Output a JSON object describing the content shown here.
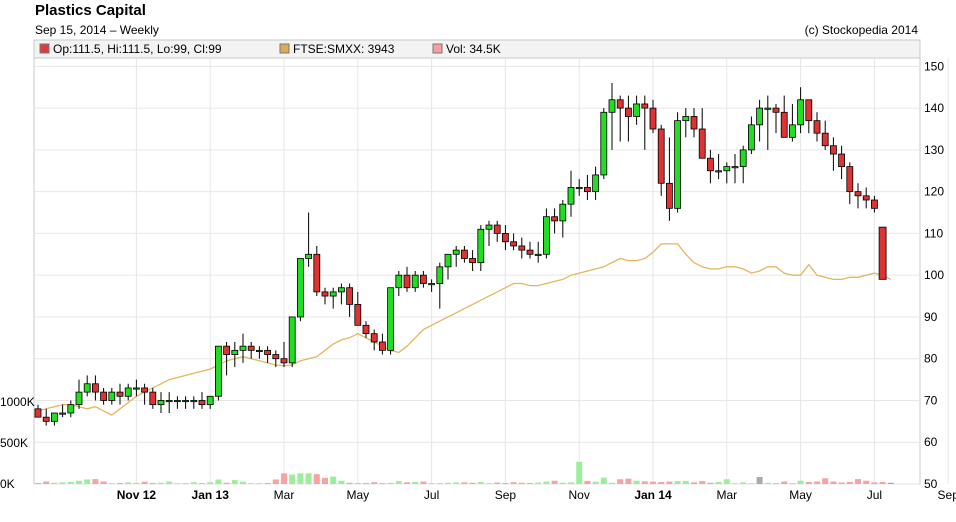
{
  "header": {
    "title": "Plastics Capital",
    "subtitle": "Sep 15, 2014  – Weekly",
    "credit": "(c) Stockopedia 2014"
  },
  "legend": [
    {
      "label": "Op:111.5, Hi:111.5, Lo:99, Cl:99",
      "color": "#e03c3c"
    },
    {
      "label": "FTSE:SMXX: 3943",
      "color": "#e0a85a"
    },
    {
      "label": "Vol: 34.5K",
      "color": "#f4a0a0"
    }
  ],
  "colors": {
    "up": "#22dd22",
    "down": "#dd3333",
    "index_line": "#e3b65f",
    "vol_up": "#9cee9c",
    "vol_down": "#f4a4a4",
    "vol_neutral": "#aaaaaa",
    "grid": "#e6e6e6"
  },
  "chart_data": {
    "type": "candlestick",
    "price_axis": {
      "ticks": [
        50,
        60,
        70,
        80,
        90,
        100,
        110,
        120,
        130,
        140,
        150
      ],
      "ylim": [
        50,
        152
      ]
    },
    "volume_axis": {
      "ticks": [
        "0K",
        "500K",
        "1000K"
      ],
      "values": [
        0,
        500,
        1000
      ]
    },
    "x_ticks": [
      {
        "label": "Nov 12",
        "week": 12,
        "bold": true
      },
      {
        "label": "Jan 13",
        "week": 21,
        "bold": true
      },
      {
        "label": "Mar",
        "week": 30,
        "bold": false
      },
      {
        "label": "May",
        "week": 39,
        "bold": false
      },
      {
        "label": "Jul",
        "week": 48,
        "bold": false
      },
      {
        "label": "Sep",
        "week": 57,
        "bold": false
      },
      {
        "label": "Nov",
        "week": 66,
        "bold": false
      },
      {
        "label": "Jan 14",
        "week": 75,
        "bold": true
      },
      {
        "label": "Mar",
        "week": 84,
        "bold": false
      },
      {
        "label": "May",
        "week": 93,
        "bold": false
      },
      {
        "label": "Jul",
        "week": 102,
        "bold": false
      },
      {
        "label": "Sep",
        "week": 111,
        "bold": false
      }
    ],
    "candles": [
      [
        68,
        69,
        66,
        66
      ],
      [
        66,
        68,
        64,
        65
      ],
      [
        65,
        67,
        64,
        67
      ],
      [
        67,
        69,
        66,
        67
      ],
      [
        67,
        70,
        66,
        69
      ],
      [
        69,
        75,
        68,
        72
      ],
      [
        72,
        76,
        71,
        74
      ],
      [
        74,
        76,
        70,
        72
      ],
      [
        72,
        73,
        69,
        70
      ],
      [
        70,
        73,
        69,
        72
      ],
      [
        72,
        74,
        69,
        71
      ],
      [
        71,
        74,
        70,
        73
      ],
      [
        73,
        75,
        71,
        73
      ],
      [
        73,
        74,
        69,
        72
      ],
      [
        72,
        73,
        68,
        69
      ],
      [
        69,
        72,
        67,
        70
      ],
      [
        70,
        72,
        67,
        70
      ],
      [
        70,
        71,
        68,
        70
      ],
      [
        70,
        71,
        68,
        70
      ],
      [
        70,
        71,
        68,
        70
      ],
      [
        70,
        72,
        68,
        69
      ],
      [
        69,
        71,
        68,
        71
      ],
      [
        71,
        82,
        70,
        83
      ],
      [
        83,
        84,
        76,
        81
      ],
      [
        81,
        84,
        78,
        82
      ],
      [
        82,
        86,
        79,
        83
      ],
      [
        83,
        84,
        80,
        82
      ],
      [
        82,
        83,
        80,
        82
      ],
      [
        82,
        83,
        79,
        81
      ],
      [
        81,
        82,
        78,
        80
      ],
      [
        80,
        84,
        78,
        79
      ],
      [
        79,
        90,
        78,
        90
      ],
      [
        90,
        104,
        89,
        104
      ],
      [
        104,
        115,
        102,
        105
      ],
      [
        105,
        107,
        95,
        96
      ],
      [
        96,
        97,
        93,
        95
      ],
      [
        95,
        97,
        92,
        96
      ],
      [
        96,
        98,
        93,
        97
      ],
      [
        97,
        98,
        90,
        93
      ],
      [
        93,
        96,
        88,
        88
      ],
      [
        88,
        89,
        85,
        86
      ],
      [
        86,
        87,
        82,
        84
      ],
      [
        84,
        86,
        81,
        82
      ],
      [
        82,
        97,
        81,
        97
      ],
      [
        97,
        101,
        95,
        100
      ],
      [
        100,
        102,
        96,
        97
      ],
      [
        97,
        101,
        96,
        100
      ],
      [
        100,
        101,
        97,
        98
      ],
      [
        98,
        99,
        96,
        98
      ],
      [
        98,
        103,
        92,
        102
      ],
      [
        102,
        105,
        99,
        105
      ],
      [
        105,
        107,
        102,
        106
      ],
      [
        106,
        107,
        103,
        104
      ],
      [
        104,
        106,
        101,
        103
      ],
      [
        103,
        112,
        101,
        111
      ],
      [
        111,
        113,
        107,
        112
      ],
      [
        112,
        113,
        108,
        110
      ],
      [
        110,
        112,
        106,
        108
      ],
      [
        108,
        110,
        106,
        107
      ],
      [
        107,
        109,
        104,
        106
      ],
      [
        106,
        108,
        104,
        105
      ],
      [
        105,
        108,
        103,
        105
      ],
      [
        105,
        116,
        104,
        114
      ],
      [
        114,
        116,
        110,
        113
      ],
      [
        113,
        118,
        109,
        117
      ],
      [
        117,
        125,
        114,
        121
      ],
      [
        121,
        123,
        119,
        121
      ],
      [
        121,
        124,
        118,
        120
      ],
      [
        120,
        126,
        118,
        124
      ],
      [
        124,
        140,
        123,
        139
      ],
      [
        139,
        146,
        130,
        142
      ],
      [
        142,
        143,
        132,
        140
      ],
      [
        140,
        143,
        132,
        138
      ],
      [
        138,
        143,
        136,
        141
      ],
      [
        141,
        143,
        130,
        140
      ],
      [
        140,
        142,
        134,
        135
      ],
      [
        135,
        136,
        119,
        122
      ],
      [
        122,
        133,
        113,
        116
      ],
      [
        116,
        139,
        115,
        137
      ],
      [
        137,
        140,
        133,
        138
      ],
      [
        138,
        140,
        133,
        135
      ],
      [
        135,
        140,
        129,
        128
      ],
      [
        128,
        130,
        122,
        125
      ],
      [
        125,
        129,
        123,
        125
      ],
      [
        125,
        127,
        122,
        126
      ],
      [
        126,
        129,
        122,
        126
      ],
      [
        126,
        131,
        122,
        130
      ],
      [
        130,
        138,
        129,
        136
      ],
      [
        136,
        142,
        132,
        140
      ],
      [
        140,
        143,
        130,
        140
      ],
      [
        140,
        141,
        134,
        139
      ],
      [
        139,
        143,
        133,
        133
      ],
      [
        133,
        141,
        132,
        136
      ],
      [
        136,
        145,
        134,
        142
      ],
      [
        142,
        142,
        134,
        137
      ],
      [
        137,
        139,
        132,
        134
      ],
      [
        134,
        137,
        130,
        131
      ],
      [
        131,
        133,
        125,
        129
      ],
      [
        129,
        131,
        123,
        126
      ],
      [
        126,
        127,
        117,
        120
      ],
      [
        120,
        122,
        116,
        119
      ],
      [
        119,
        121,
        116,
        118
      ],
      [
        118,
        119,
        115,
        116
      ],
      [
        111.5,
        111.5,
        99,
        99
      ]
    ],
    "index_line": [
      67.5,
      68,
      68.5,
      69,
      69,
      68.5,
      68,
      68.5,
      67.5,
      66.5,
      68,
      69.5,
      71,
      72,
      73,
      74,
      75,
      75.5,
      76,
      76.5,
      77,
      77.5,
      78.5,
      79.5,
      80,
      80.5,
      80,
      79.5,
      79,
      78.5,
      78.3,
      78.5,
      79.5,
      80,
      80.5,
      82,
      83.5,
      84.5,
      85,
      86,
      85,
      84,
      83,
      82,
      81.5,
      83,
      85,
      87,
      88,
      89,
      90,
      91,
      92,
      93,
      94,
      95,
      96,
      97,
      98,
      98,
      97.5,
      97.5,
      98,
      98.5,
      99,
      100,
      100.5,
      101,
      101.5,
      102,
      103,
      104,
      103.5,
      103.5,
      104,
      105.5,
      107.5,
      107.5,
      107.5,
      105,
      103,
      102,
      101.5,
      101.5,
      102,
      102,
      101.5,
      100.5,
      101,
      102,
      102,
      100.5,
      100,
      100,
      102.5,
      100,
      99.5,
      99,
      99,
      99.5,
      99.5,
      100,
      100.5,
      100,
      99
    ],
    "volume": [
      12,
      30,
      15,
      20,
      25,
      40,
      55,
      60,
      30,
      10,
      12,
      20,
      15,
      28,
      12,
      15,
      30,
      10,
      12,
      22,
      10,
      22,
      55,
      15,
      48,
      28,
      8,
      10,
      12,
      55,
      130,
      115,
      130,
      130,
      120,
      75,
      90,
      40,
      15,
      10,
      12,
      22,
      10,
      15,
      35,
      20,
      25,
      30,
      10,
      12,
      15,
      18,
      20,
      15,
      25,
      10,
      18,
      12,
      22,
      15,
      12,
      18,
      30,
      40,
      15,
      20,
      270,
      38,
      28,
      78,
      15,
      58,
      65,
      40,
      33,
      28,
      25,
      30,
      35,
      38,
      20,
      35,
      15,
      25,
      58,
      10,
      20,
      10,
      85,
      15,
      10,
      30,
      12,
      40,
      25,
      30,
      70,
      30,
      18,
      25,
      60,
      40,
      20,
      25,
      15
    ]
  }
}
